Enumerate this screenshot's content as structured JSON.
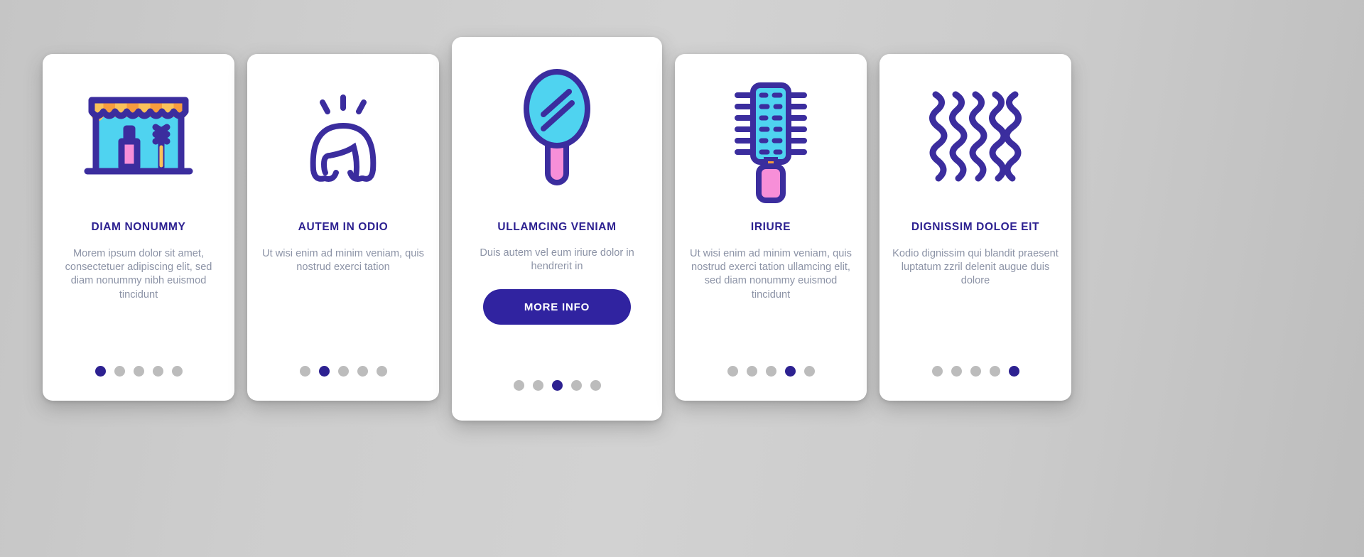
{
  "theme": {
    "background_start": "#c5c5c5",
    "background_end": "#bdbdbd",
    "card_bg": "#ffffff",
    "title_color": "#2d2191",
    "body_color": "#8c93a6",
    "accent": "#3023a0",
    "dot_inactive": "#bcbcbc",
    "icon_outline": "#3b2d9e",
    "icon_cyan": "#4fd3f0",
    "icon_pink": "#f78fd8",
    "icon_orange": "#f79c3e",
    "icon_yellow": "#fbc25a"
  },
  "cards": [
    {
      "id": "card-1",
      "icon": "beauty-salon-storefront-icon",
      "title": "DIAM NONUMMY",
      "body": "Morem ipsum dolor sit amet, consectetuer adipiscing elit, sed diam nonummy nibh euismod tincidunt",
      "dots_total": 5,
      "dots_active": 1,
      "has_button": false,
      "button_label": ""
    },
    {
      "id": "card-2",
      "icon": "wig-hairstyle-icon",
      "title": "AUTEM IN ODIO",
      "body": "Ut wisi enim ad minim veniam, quis nostrud exerci tation",
      "dots_total": 5,
      "dots_active": 2,
      "has_button": false,
      "button_label": ""
    },
    {
      "id": "card-3",
      "icon": "hand-mirror-icon",
      "title": "ULLAMCING VENIAM",
      "body": "Duis autem vel eum iriure dolor in hendrerit in",
      "dots_total": 5,
      "dots_active": 3,
      "has_button": true,
      "button_label": "MORE INFO"
    },
    {
      "id": "card-4",
      "icon": "hair-brush-icon",
      "title": "IRIURE",
      "body": "Ut wisi enim ad minim veniam, quis nostrud exerci tation ullamcing elit, sed diam nonummy euismod tincidunt",
      "dots_total": 5,
      "dots_active": 4,
      "has_button": false,
      "button_label": ""
    },
    {
      "id": "card-5",
      "icon": "wavy-hair-curls-icon",
      "title": "DIGNISSIM DOLOE EIT",
      "body": "Kodio dignissim qui blandit praesent luptatum zzril delenit augue duis dolore",
      "dots_total": 5,
      "dots_active": 5,
      "has_button": false,
      "button_label": ""
    }
  ]
}
